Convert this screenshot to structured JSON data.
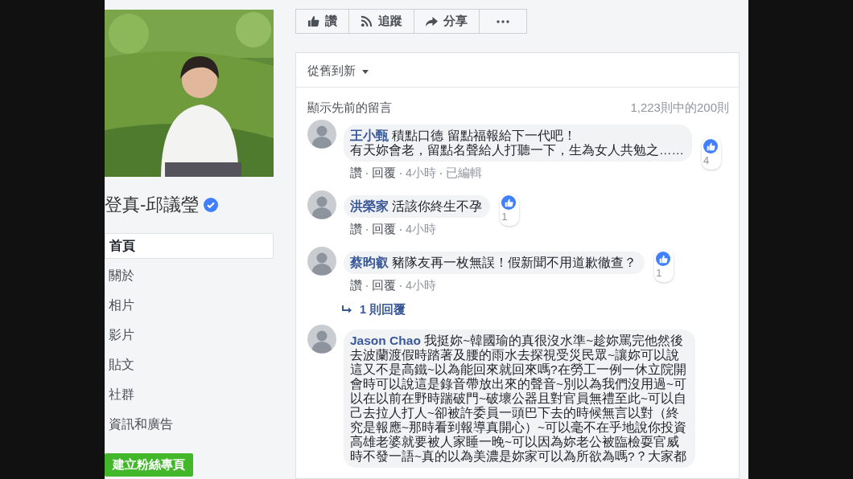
{
  "page": {
    "name": "登真-邱議瑩",
    "verified": true,
    "nav": [
      {
        "label": "首頁",
        "selected": true
      },
      {
        "label": "關於",
        "selected": false
      },
      {
        "label": "相片",
        "selected": false
      },
      {
        "label": "影片",
        "selected": false
      },
      {
        "label": "貼文",
        "selected": false
      },
      {
        "label": "社群",
        "selected": false
      },
      {
        "label": "資訊和廣告",
        "selected": false
      }
    ],
    "create_button": "建立粉絲專頁"
  },
  "actions": [
    {
      "kind": "like",
      "label": "讚"
    },
    {
      "kind": "follow",
      "label": "追蹤"
    },
    {
      "kind": "share",
      "label": "分享"
    },
    {
      "kind": "more"
    }
  ],
  "comments": {
    "sort": "從舊到新",
    "show_previous": "顯示先前的留言",
    "count": "1,223則中的200則",
    "items": [
      {
        "author": "王小甄",
        "text": "積點口德 留點福報給下一代吧！",
        "more_lines": [
          "有天妳會老，留點名聲給人打聽一下，生為女人共勉之……"
        ],
        "reactions": "4",
        "meta": [
          {
            "kind": "link",
            "label": "讚"
          },
          {
            "kind": "link",
            "label": "回覆"
          },
          {
            "kind": "text",
            "label": "4小時"
          },
          {
            "kind": "text",
            "label": "已編輯"
          }
        ]
      },
      {
        "author": "洪榮家",
        "text": "活該你終生不孕",
        "reactions": "1",
        "meta": [
          {
            "kind": "link",
            "label": "讚"
          },
          {
            "kind": "link",
            "label": "回覆"
          },
          {
            "kind": "text",
            "label": "4小時"
          }
        ]
      },
      {
        "author": "蔡昀叡",
        "text": "豬隊友再一枚無誤！假新聞不用道歉徹查？",
        "reactions": "1",
        "meta": [
          {
            "kind": "link",
            "label": "讚"
          },
          {
            "kind": "link",
            "label": "回覆"
          },
          {
            "kind": "text",
            "label": "4小時"
          }
        ],
        "replies": "1 則回覆"
      },
      {
        "author": "Jason Chao",
        "text": "我挺妳~韓國瑜的真很沒水準~趁妳罵完他然後去波蘭渡假時踏著及腰的雨水去探視受災民眾~讓妳可以說這又不是高鐵~以為能回來就回來嗎?在勞工一例一休立院開會時可以說這是錄音帶放出來的聲音~別以為我們沒用過~可以在以前在野時踹破門~破壞公器且對官員無禮至此~可以自己去拉人打人~卻被許委員一頭巴下去的時候無言以對（終究是報應~那時看到報導真開心）~可以毫不在乎地說你投資高雄老婆就要被人家睡一晚~可以因為妳老公被臨檢耍官威時不發一語~真的以為美濃是妳家可以為所欲為嗎?？大家都"
      }
    ]
  }
}
